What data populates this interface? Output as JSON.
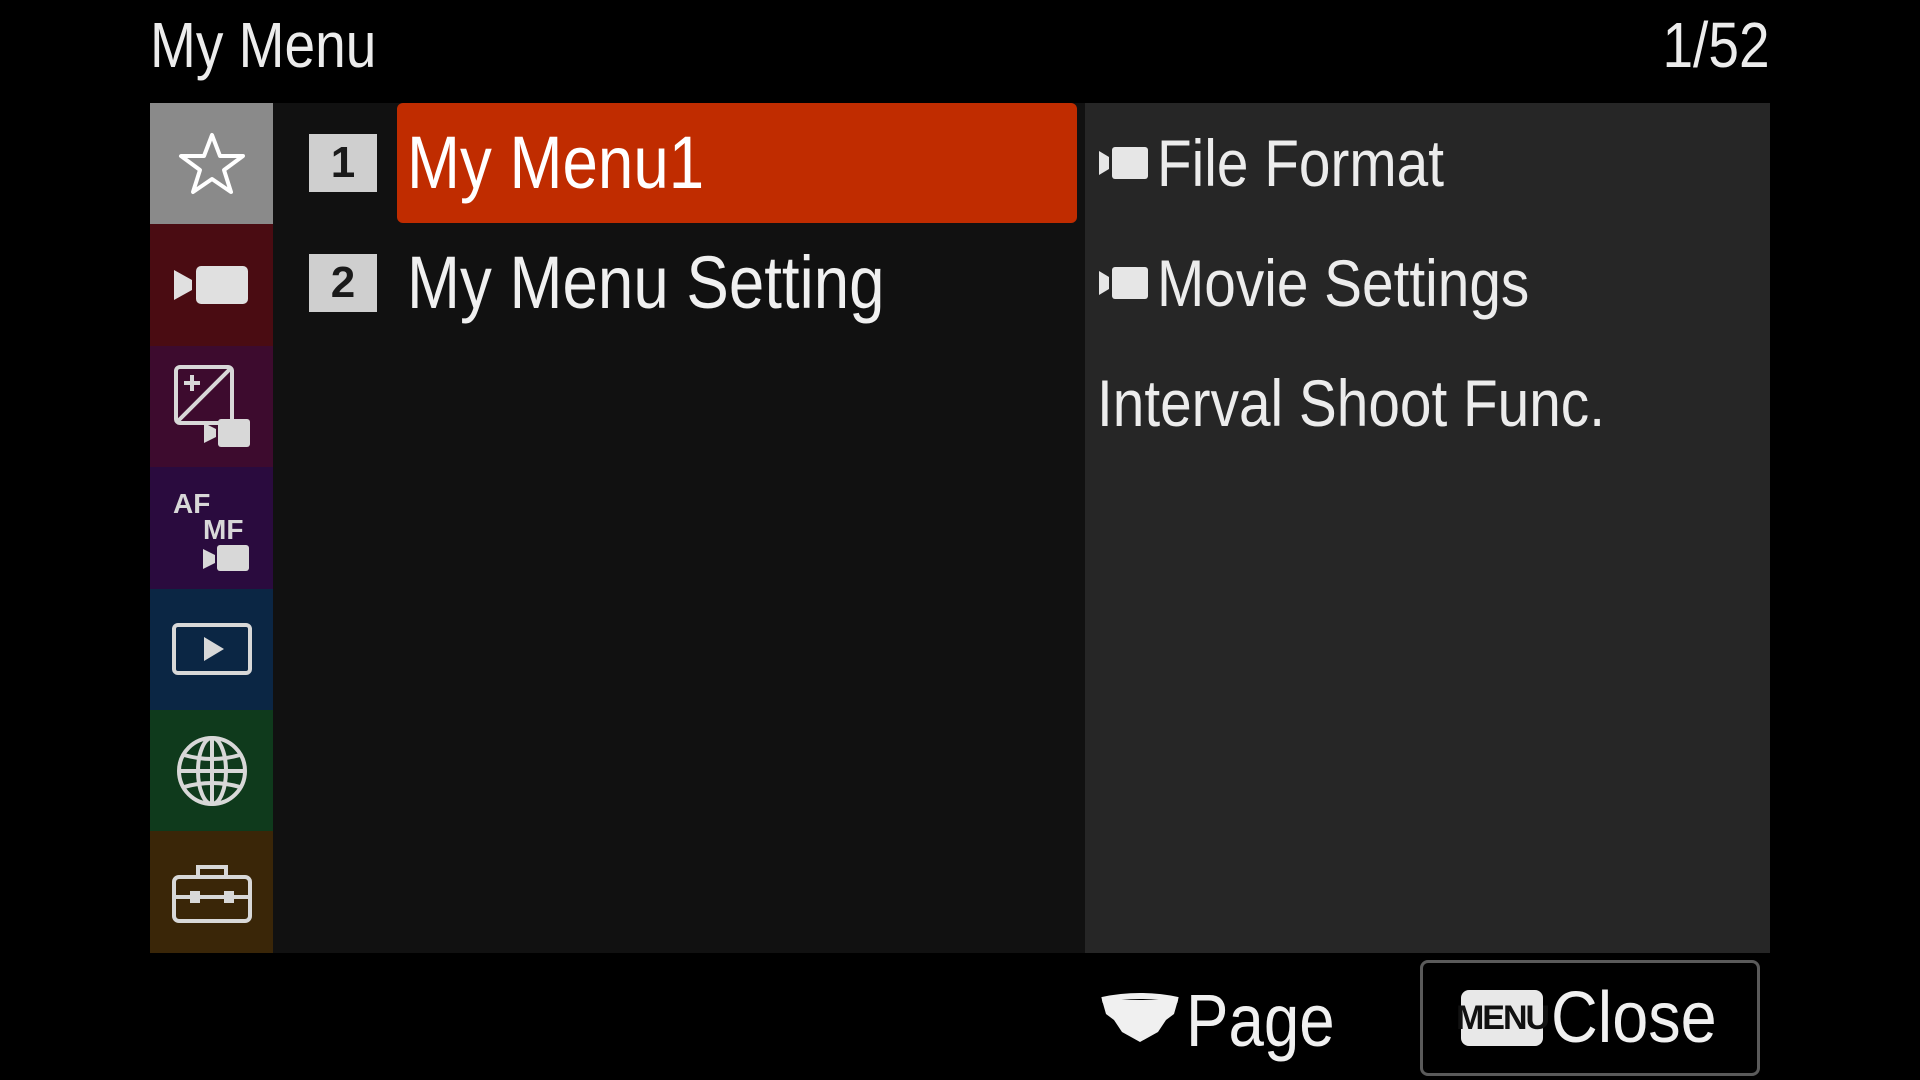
{
  "header": {
    "title": "My Menu",
    "page_indicator": "1/52"
  },
  "tabs": [
    {
      "name": "my-menu",
      "icon": "star-icon",
      "color": "#8a8a8a"
    },
    {
      "name": "shooting-movie",
      "icon": "movie-camera-icon",
      "color": "#4a0c12"
    },
    {
      "name": "exposure-color",
      "icon": "exposure-compensation-movie-icon",
      "color": "#3d0b2e"
    },
    {
      "name": "focus",
      "icon": "af-mf-movie-icon",
      "color": "#2a0b3e"
    },
    {
      "name": "playback",
      "icon": "playback-icon",
      "color": "#0b2644"
    },
    {
      "name": "network",
      "icon": "globe-icon",
      "color": "#0f3a1c"
    },
    {
      "name": "setup",
      "icon": "toolbox-icon",
      "color": "#3a2608"
    }
  ],
  "list": {
    "items": [
      {
        "number": "1",
        "label": "My Menu1",
        "selected": true
      },
      {
        "number": "2",
        "label": "My Menu Setting",
        "selected": false
      }
    ]
  },
  "preview": {
    "items": [
      {
        "label": "File Format",
        "icon": "movie-camera-icon"
      },
      {
        "label": "Movie Settings",
        "icon": "movie-camera-icon"
      },
      {
        "label": "Interval Shoot Func.",
        "icon": ""
      }
    ]
  },
  "footer": {
    "page_label": "Page",
    "page_icon": "control-wheel-icon",
    "menu_badge": "MENU",
    "close_label": "Close"
  },
  "colors": {
    "selected_row": "#c02c00",
    "list_background": "#111111",
    "preview_background": "#262626"
  }
}
